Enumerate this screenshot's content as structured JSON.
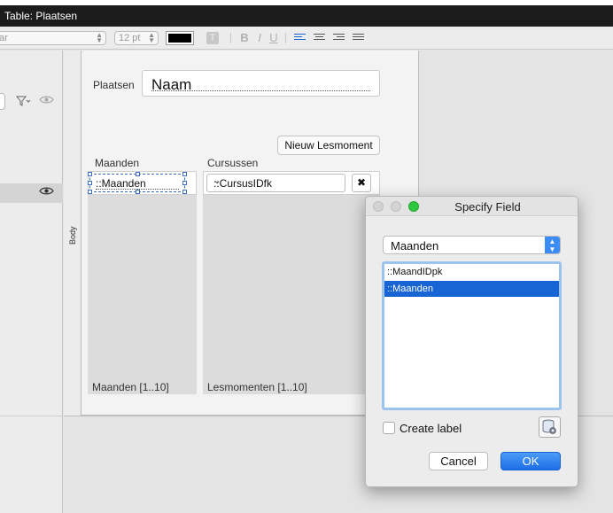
{
  "window": {
    "title": "Table: Plaatsen"
  },
  "toolbar": {
    "font_partial": "ar",
    "font_size": "12 pt",
    "text_color": "#000000",
    "bold": "B",
    "italic": "I",
    "underline": "U",
    "text_style_icon": "T"
  },
  "icons": {
    "filter": "filter-icon",
    "eye": "eye-icon",
    "delete": "close-x-icon",
    "database_options": "database-gear-icon"
  },
  "layout": {
    "body_part_label": "Body",
    "plaatsen_label": "Plaatsen",
    "naam_field": "Naam",
    "new_button": "Nieuw Lesmoment",
    "maanden_label": "Maanden",
    "cursussen_label": "Cursussen",
    "maanden_field": "::Maanden",
    "cursus_dropdown": "::CursusIDfk",
    "maanden_portal_count": "Maanden [1..10]",
    "lesmomenten_portal_count": "Lesmomenten [1..10]"
  },
  "dialog": {
    "title": "Specify Field",
    "table_select": "Maanden",
    "fields": [
      {
        "name": "::MaandIDpk",
        "selected": false
      },
      {
        "name": "::Maanden",
        "selected": true
      }
    ],
    "create_label": "Create label",
    "create_label_checked": false,
    "cancel": "Cancel",
    "ok": "OK"
  },
  "colors": {
    "selection": "#1764d4",
    "default_button": "#1d6fe8",
    "zoom_button": "#2ec840"
  }
}
